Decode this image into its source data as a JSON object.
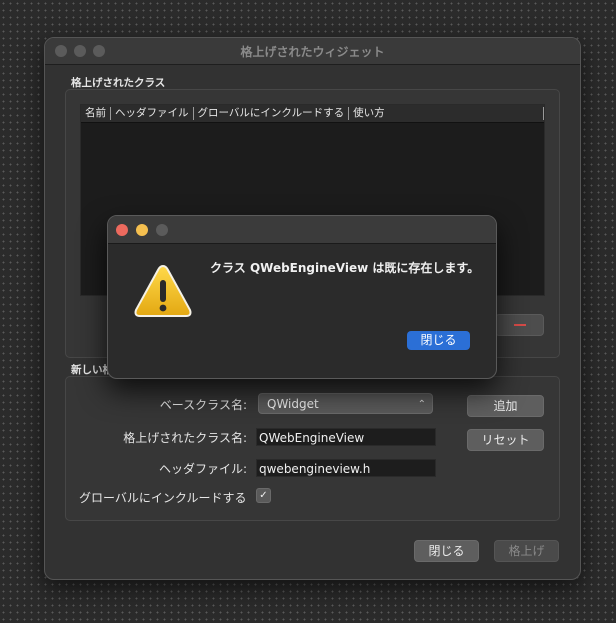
{
  "window": {
    "title": "格上げされたウィジェット"
  },
  "promoted_group": {
    "label": "格上げされたクラス",
    "columns": [
      "名前",
      "ヘッダファイル",
      "グローバルにインクルードする",
      "使い方"
    ]
  },
  "new_group": {
    "label": "新しい格上げされたクラス",
    "base_class_label": "ベースクラス名:",
    "base_class_value": "QWidget",
    "promoted_class_label": "格上げされたクラス名:",
    "promoted_class_value": "QWebEngineView",
    "header_file_label": "ヘッダファイル:",
    "header_file_value": "qwebengineview.h",
    "global_include_label": "グローバルにインクルードする",
    "global_include_checked": true,
    "add_button": "追加",
    "reset_button": "リセット"
  },
  "footer": {
    "close_button": "閉じる",
    "promote_button": "格上げ"
  },
  "dialog": {
    "message": "クラス QWebEngineView は既に存在します。",
    "close_button": "閉じる"
  },
  "colors": {
    "accent": "#2b6fd6",
    "close_light": "#ed6a5e",
    "minimize_light": "#f5bf4f",
    "warning": "#f2c230"
  },
  "icons": {
    "warning": "warning-triangle-icon",
    "remove": "minus-icon",
    "combo": "chevron-updown-icon",
    "checkbox": "check-icon"
  }
}
